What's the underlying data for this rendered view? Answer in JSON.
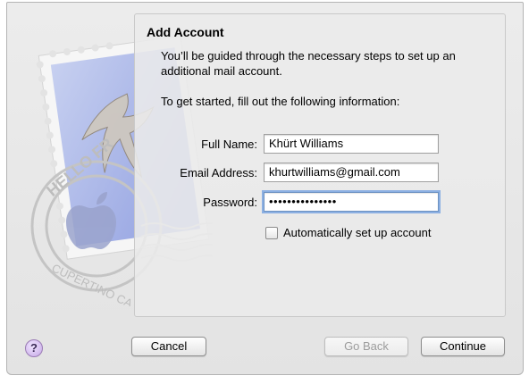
{
  "dialog": {
    "title": "Add Account",
    "intro": "You’ll be guided through the necessary steps to set up an additional mail account.",
    "prompt": "To get started, fill out the following information:"
  },
  "form": {
    "full_name": {
      "label": "Full Name:",
      "value": "Khürt Williams"
    },
    "email": {
      "label": "Email Address:",
      "value": "khurtwilliams@gmail.com"
    },
    "password": {
      "label": "Password:",
      "value": "•••••••••••••••"
    },
    "auto_setup": {
      "label": "Automatically set up account",
      "checked": false
    }
  },
  "buttons": {
    "help": "?",
    "cancel": "Cancel",
    "go_back": "Go Back",
    "continue": "Continue"
  },
  "stamp": {
    "text_top": "HELLO FR",
    "text_bottom": "CUPERTINO CA"
  },
  "colors": {
    "stamp_blue": "#a9b6e6",
    "focus_ring": "#8cb0e3"
  }
}
